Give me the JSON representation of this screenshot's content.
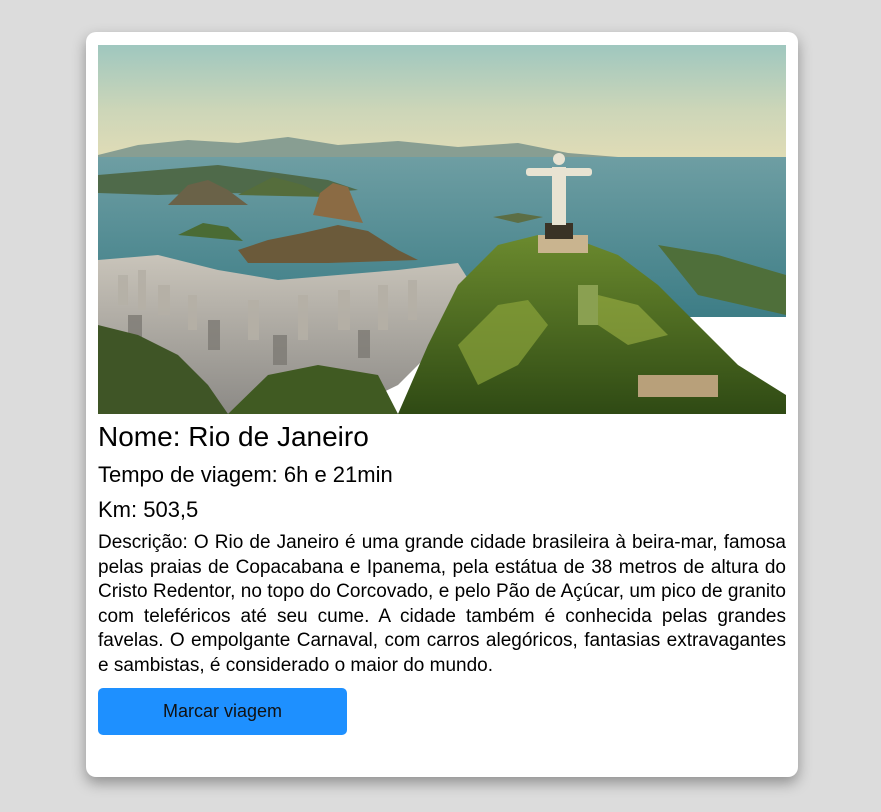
{
  "destination": {
    "image_alt": "Rio de Janeiro",
    "name_text": "Nome: Rio de Janeiro",
    "travel_time_text": "Tempo de viagem: 6h e 21min",
    "distance_text": "Km: 503,5",
    "description_text": "Descrição: O Rio de Janeiro é uma grande cidade brasileira à beira-mar, famosa pelas praias de Copacabana e Ipanema, pela estátua de 38 metros de altura do Cristo Redentor, no topo do Corcovado, e pelo Pão de Açúcar, um pico de granito com teleféricos até seu cume. A cidade também é conhecida pelas grandes favelas. O empolgante Carnaval, com carros alegóricos, fantasias extravagantes e sambistas, é considerado o maior do mundo."
  },
  "actions": {
    "book_trip_label": "Marcar viagem",
    "button_color": "#1e90ff"
  },
  "colors": {
    "page_background": "#dcdcdc",
    "card_background": "#ffffff"
  }
}
